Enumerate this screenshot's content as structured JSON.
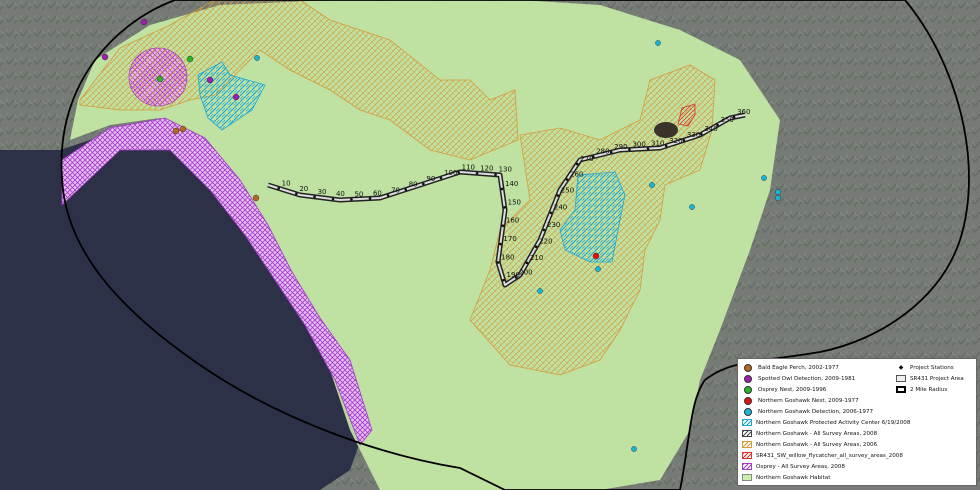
{
  "legend": {
    "left_items": [
      {
        "label": "Bald Eagle Perch, 2002-1977",
        "symbol": "dot",
        "color": "#b26a1e",
        "icon": "bald-eagle-perch-icon"
      },
      {
        "label": "Spotted Owl Detection, 2009-1981",
        "symbol": "dot",
        "color": "#9c1fb0",
        "icon": "spotted-owl-icon"
      },
      {
        "label": "Osprey Nest, 2009-1996",
        "symbol": "dot",
        "color": "#2ab52a",
        "icon": "osprey-nest-icon"
      },
      {
        "label": "Northern Goshawk Nest, 2009-1977",
        "symbol": "dot",
        "color": "#e01010",
        "icon": "goshawk-nest-icon"
      },
      {
        "label": "Northern Goshawk Detection, 2006-1977",
        "symbol": "dot",
        "color": "#17b6d6",
        "icon": "goshawk-detection-icon"
      },
      {
        "label": "Northern Goshawk Protected Activity Center 6/19/2008",
        "symbol": "hatch",
        "color": "#1aa6d8",
        "icon": "goshawk-pac-icon"
      },
      {
        "label": "Northern Goshawk - All Survey Areas, 2008",
        "symbol": "hatch",
        "color": "#444444",
        "icon": "goshawk-survey-2008-icon"
      },
      {
        "label": "Northern Goshawk - All Survey Areas, 2006",
        "symbol": "hatch",
        "color": "#d59a3a",
        "icon": "goshawk-survey-2006-icon"
      },
      {
        "label": "SR431_SW_willow_flycatcher_all_survey_areas_2008",
        "symbol": "hatch",
        "color": "#e0312a",
        "icon": "willow-flycatcher-icon"
      },
      {
        "label": "Osprey - All Survey Areas, 2008",
        "symbol": "hatch",
        "color": "#a23ac8",
        "icon": "osprey-survey-icon"
      },
      {
        "label": "Northern Goshawk Habitat",
        "symbol": "fill",
        "color": "#c9f0a8",
        "icon": "goshawk-habitat-icon"
      }
    ],
    "right_items": [
      {
        "label": "Project Stations",
        "symbol": "diamond",
        "icon": "project-stations-icon"
      },
      {
        "label": "SR431 Project Area",
        "symbol": "road",
        "icon": "project-area-icon"
      },
      {
        "label": "2 Mile Radius",
        "symbol": "outline",
        "icon": "radius-icon"
      }
    ]
  },
  "stations": [
    "10",
    "20",
    "30",
    "40",
    "50",
    "60",
    "70",
    "80",
    "90",
    "100",
    "110",
    "120",
    "130",
    "140",
    "150",
    "160",
    "170",
    "180",
    "190",
    "200",
    "210",
    "220",
    "230",
    "240",
    "250",
    "260",
    "270",
    "280",
    "290",
    "300",
    "310",
    "320",
    "330",
    "340",
    "350",
    "360"
  ],
  "colors": {
    "habitat": "#c9f0a8",
    "survey_2006": "#d59a3a",
    "pac": "#1aa6d8",
    "osprey_survey": "#a23ac8",
    "flycatcher": "#e0312a",
    "lake": "#2c3148",
    "terrain": "#7a7f78"
  }
}
